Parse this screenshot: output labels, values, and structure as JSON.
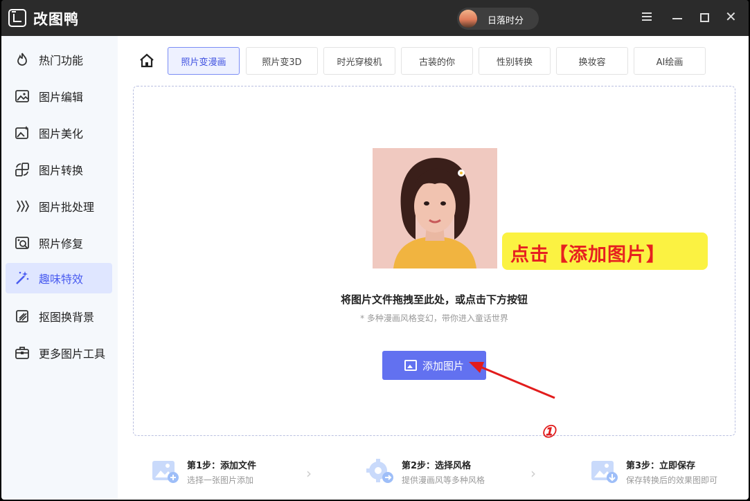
{
  "app": {
    "title": "改图鸭",
    "user_name": "日落时分"
  },
  "sidebar": {
    "items": [
      {
        "label": "热门功能",
        "icon": "fire-icon"
      },
      {
        "label": "图片编辑",
        "icon": "image-edit-icon"
      },
      {
        "label": "图片美化",
        "icon": "image-beautify-icon"
      },
      {
        "label": "图片转换",
        "icon": "image-convert-icon"
      },
      {
        "label": "图片批处理",
        "icon": "batch-icon"
      },
      {
        "label": "照片修复",
        "icon": "photo-repair-icon"
      },
      {
        "label": "趣味特效",
        "icon": "magic-wand-icon",
        "active": true
      },
      {
        "label": "抠图换背景",
        "icon": "cutout-icon"
      },
      {
        "label": "更多图片工具",
        "icon": "toolbox-icon"
      }
    ]
  },
  "tabs": [
    {
      "label": "照片变漫画",
      "active": true
    },
    {
      "label": "照片变3D"
    },
    {
      "label": "时光穿梭机"
    },
    {
      "label": "古装的你"
    },
    {
      "label": "性别转换"
    },
    {
      "label": "换妆容"
    },
    {
      "label": "AI绘画"
    }
  ],
  "dropzone": {
    "callout": "点击【添加图片】",
    "title": "将图片文件拖拽至此处，或点击下方按钮",
    "subtitle": "* 多种漫画风格变幻，带你进入童话世界",
    "add_button": "添加图片",
    "annotation_number": "①"
  },
  "steps": [
    {
      "title": "第1步：添加文件",
      "desc": "选择一张图片添加"
    },
    {
      "title": "第2步：选择风格",
      "desc": "提供漫画风等多种风格"
    },
    {
      "title": "第3步：立即保存",
      "desc": "保存转换后的效果图即可"
    }
  ],
  "colors": {
    "accent": "#6271f0",
    "callout_bg": "#fbf242",
    "callout_text": "#e62020",
    "annotation": "#e21c1c"
  }
}
